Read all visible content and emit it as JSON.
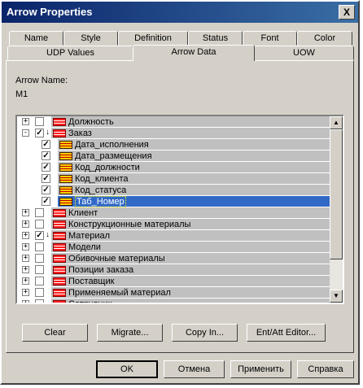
{
  "window": {
    "title": "Arrow Properties",
    "close_glyph": "X"
  },
  "tabs_row1": [
    "Name",
    "Style",
    "Definition",
    "Status",
    "Font",
    "Color"
  ],
  "tabs_row2": [
    "UDP Values",
    "Arrow Data",
    "UOW"
  ],
  "active_tab": "Arrow Data",
  "arrow_name": {
    "label": "Arrow Name:",
    "value": "M1"
  },
  "tree": {
    "rows": [
      {
        "label": "Должность",
        "kind": "entity",
        "level": 0,
        "expander": "+",
        "checked": false,
        "down": false,
        "selected": false
      },
      {
        "label": "Заказ",
        "kind": "entity",
        "level": 0,
        "expander": "-",
        "checked": true,
        "down": true,
        "selected": false
      },
      {
        "label": "Дата_исполнения",
        "kind": "attribute",
        "level": 1,
        "checked": true,
        "selected": false
      },
      {
        "label": "Дата_размещения",
        "kind": "attribute",
        "level": 1,
        "checked": true,
        "selected": false
      },
      {
        "label": "Код_должности",
        "kind": "attribute",
        "level": 1,
        "checked": true,
        "selected": false
      },
      {
        "label": "Код_клиента",
        "kind": "attribute",
        "level": 1,
        "checked": true,
        "selected": false
      },
      {
        "label": "Код_статуса",
        "kind": "attribute",
        "level": 1,
        "checked": true,
        "selected": false
      },
      {
        "label": "Таб_Номер",
        "kind": "attribute",
        "level": 1,
        "checked": true,
        "selected": true
      },
      {
        "label": "Клиент",
        "kind": "entity",
        "level": 0,
        "expander": "+",
        "checked": false,
        "down": false,
        "selected": false
      },
      {
        "label": "Конструкционные материалы",
        "kind": "entity",
        "level": 0,
        "expander": "+",
        "checked": false,
        "down": false,
        "selected": false
      },
      {
        "label": "Материал",
        "kind": "entity",
        "level": 0,
        "expander": "+",
        "checked": true,
        "down": true,
        "selected": false
      },
      {
        "label": "Модели",
        "kind": "entity",
        "level": 0,
        "expander": "+",
        "checked": false,
        "down": false,
        "selected": false
      },
      {
        "label": "Обивочные материалы",
        "kind": "entity",
        "level": 0,
        "expander": "+",
        "checked": false,
        "down": false,
        "selected": false
      },
      {
        "label": "Позиции заказа",
        "kind": "entity",
        "level": 0,
        "expander": "+",
        "checked": false,
        "down": false,
        "selected": false
      },
      {
        "label": "Поставщик",
        "kind": "entity",
        "level": 0,
        "expander": "+",
        "checked": false,
        "down": false,
        "selected": false
      },
      {
        "label": "Применяемый материал",
        "kind": "entity",
        "level": 0,
        "expander": "+",
        "checked": false,
        "down": false,
        "selected": false
      },
      {
        "label": "Сотрудник",
        "kind": "entity",
        "level": 0,
        "expander": "+",
        "checked": false,
        "down": false,
        "selected": false
      }
    ],
    "scroll_up_glyph": "▲",
    "scroll_down_glyph": "▼"
  },
  "actions": {
    "clear": "Clear",
    "migrate": "Migrate...",
    "copy_in": "Copy In...",
    "editor": "Ent/Att Editor..."
  },
  "footer": {
    "ok": "OK",
    "cancel": "Отмена",
    "apply": "Применить",
    "help": "Справка"
  }
}
